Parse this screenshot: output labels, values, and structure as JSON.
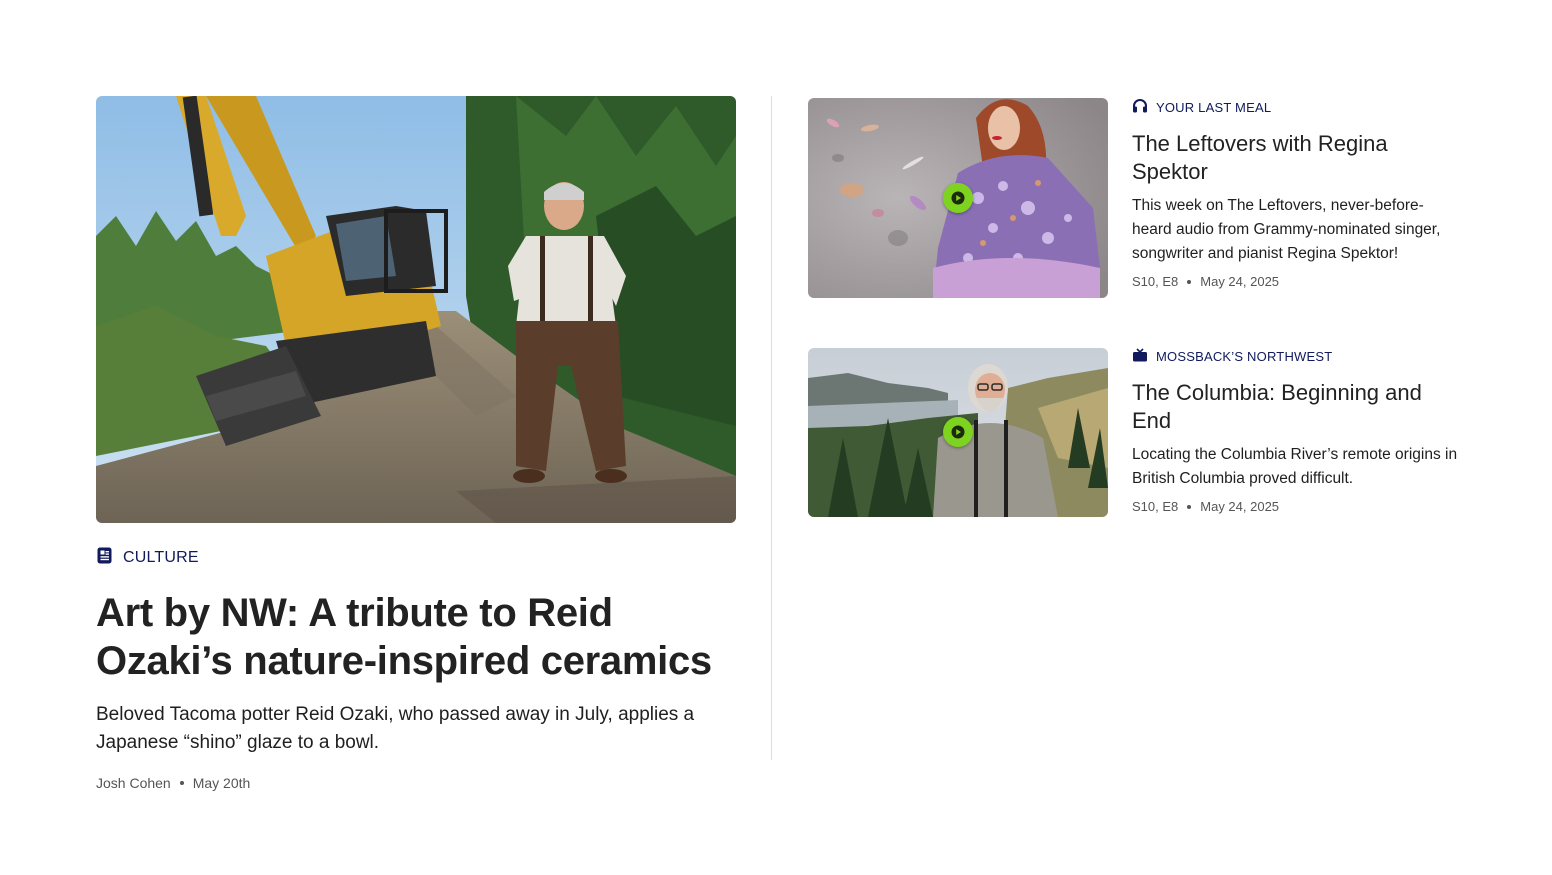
{
  "featured": {
    "category": "CULTURE",
    "category_icon": "document-icon",
    "title": "Art by NW: A tribute to Reid Ozaki’s nature-inspired ceramics",
    "dek": "Beloved Tacoma potter Reid Ozaki, who passed away in July, applies a Japanese “shino” glaze to a bowl.",
    "author": "Josh Cohen",
    "date": "May 20th"
  },
  "cards": [
    {
      "category": "YOUR LAST MEAL",
      "category_icon": "headphones-icon",
      "title": "The Leftovers with Regina Spektor",
      "dek": "This week on The Leftovers, never-before-heard audio from Grammy-nominated singer, songwriter and pianist Regina Spektor!",
      "episode": "S10, E8",
      "date": "May 24, 2025"
    },
    {
      "category": "MOSSBACK’S NORTHWEST",
      "category_icon": "tv-icon",
      "title": "The Columbia: Beginning and End",
      "dek": "Locating the Columbia River’s remote origins in British Columbia proved difficult.",
      "episode": "S10, E8",
      "date": "May 24, 2025"
    }
  ],
  "colors": {
    "kicker": "#101a5c",
    "play_button": "#7ed321",
    "divider": "#dddddd"
  }
}
